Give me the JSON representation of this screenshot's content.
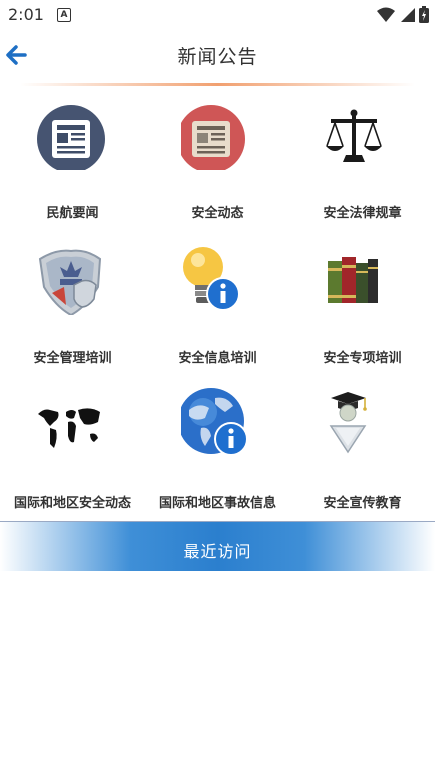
{
  "status": {
    "time": "2:01",
    "notification_letter": "A"
  },
  "header": {
    "title": "新闻公告"
  },
  "grid": {
    "items": [
      {
        "label": "民航要闻",
        "icon": "newspaper-icon"
      },
      {
        "label": "安全动态",
        "icon": "newspaper-red-icon"
      },
      {
        "label": "安全法律规章",
        "icon": "scales-icon"
      },
      {
        "label": "安全管理培训",
        "icon": "shield-icon"
      },
      {
        "label": "安全信息培训",
        "icon": "lightbulb-info-icon"
      },
      {
        "label": "安全专项培训",
        "icon": "books-icon"
      },
      {
        "label": "国际和地区安全动态",
        "icon": "world-map-icon"
      },
      {
        "label": "国际和地区事故信息",
        "icon": "globe-info-icon"
      },
      {
        "label": "安全宣传教育",
        "icon": "graduation-icon"
      }
    ]
  },
  "footer": {
    "recent_label": "最近访问"
  },
  "colors": {
    "accent_blue": "#2b7fce",
    "divider_orange": "#f1a070",
    "back_arrow": "#1e6fc4"
  }
}
